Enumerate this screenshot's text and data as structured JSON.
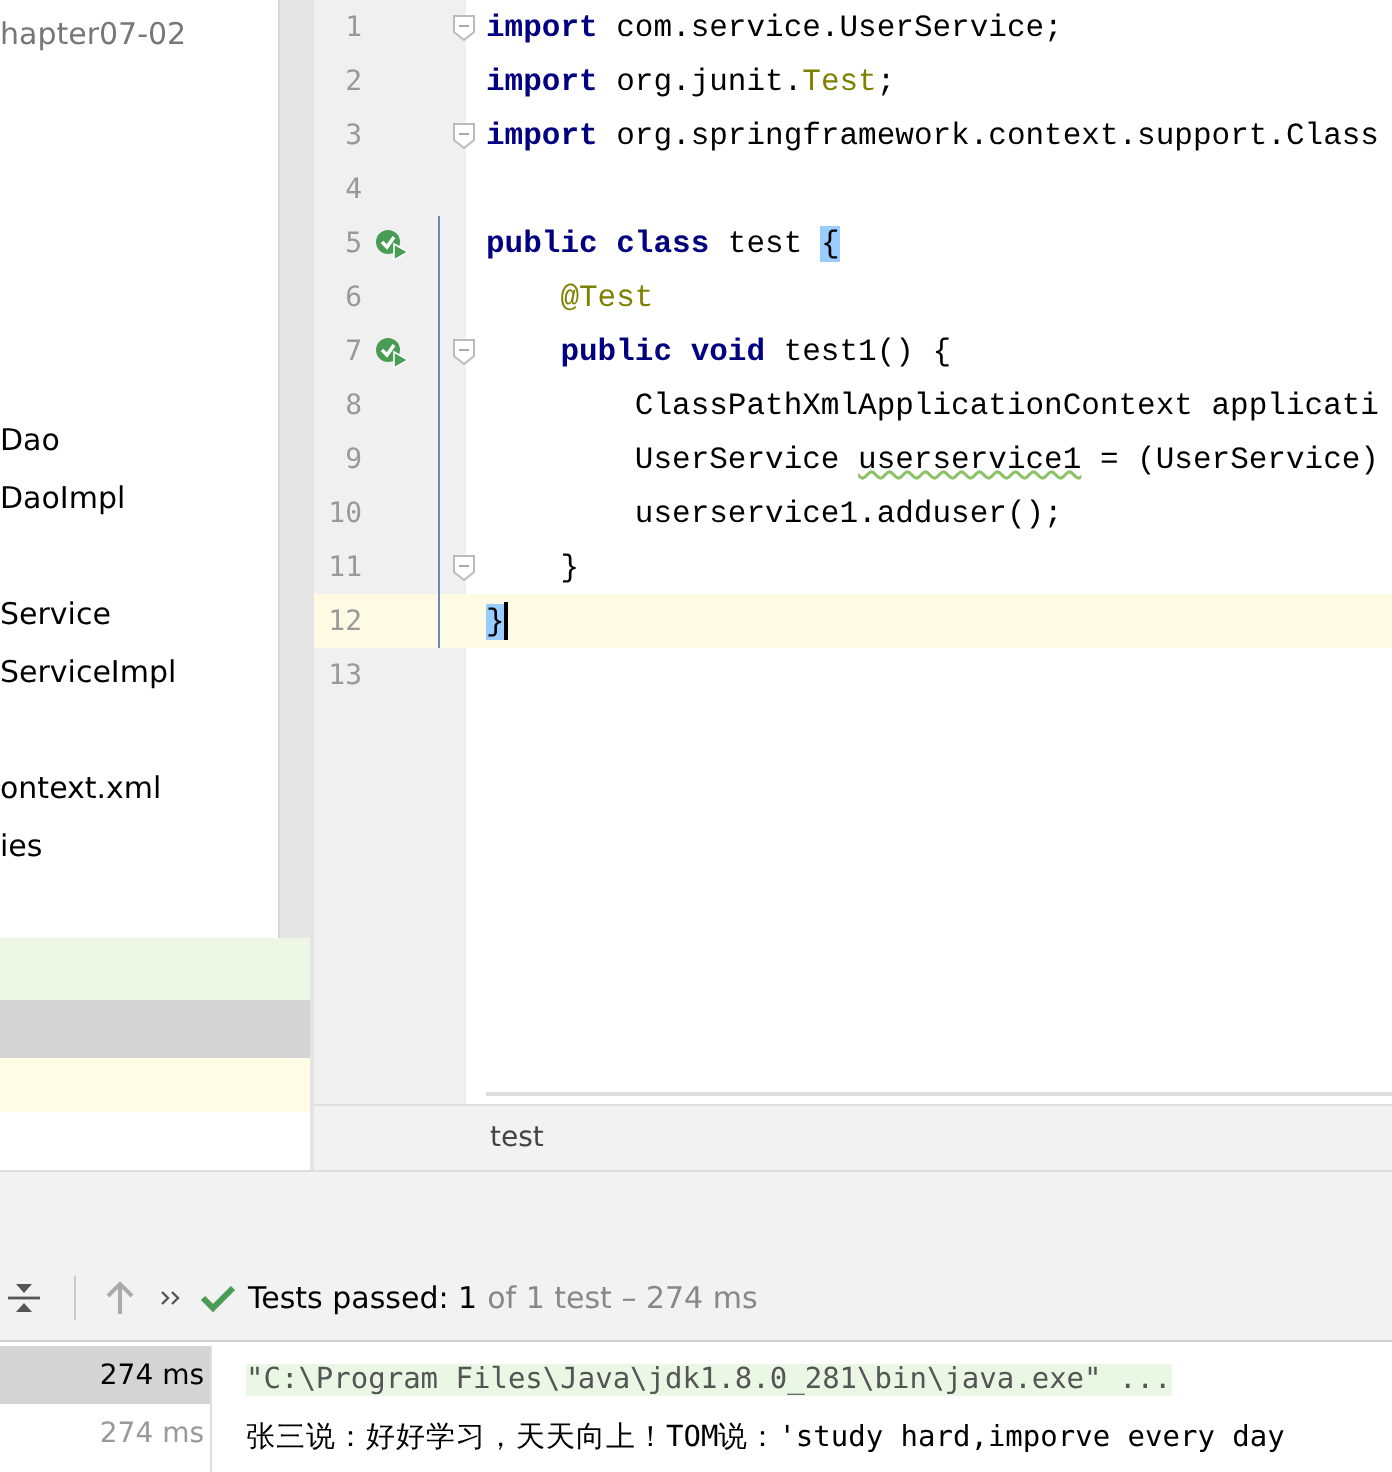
{
  "project_tree": {
    "items": [
      {
        "label": "hapter07-02",
        "kind": "root"
      },
      {
        "label": "Dao",
        "kind": "file"
      },
      {
        "label": "DaoImpl",
        "kind": "file"
      },
      {
        "label": "Service",
        "kind": "file"
      },
      {
        "label": "ServiceImpl",
        "kind": "file"
      },
      {
        "label": "ontext.xml",
        "kind": "file"
      },
      {
        "label": "ies",
        "kind": "file"
      }
    ]
  },
  "editor": {
    "lines": [
      {
        "number": "1",
        "fold": true,
        "run": false,
        "changed": false,
        "current": false,
        "tokens": [
          {
            "text": "import",
            "kind": "keyword"
          },
          {
            "text": " com.service.UserService;",
            "kind": "plain"
          }
        ]
      },
      {
        "number": "2",
        "fold": false,
        "run": false,
        "changed": false,
        "current": false,
        "tokens": [
          {
            "text": "import",
            "kind": "keyword"
          },
          {
            "text": " org.junit.",
            "kind": "plain"
          },
          {
            "text": "Test",
            "kind": "annotation"
          },
          {
            "text": ";",
            "kind": "plain"
          }
        ]
      },
      {
        "number": "3",
        "fold": true,
        "run": false,
        "changed": false,
        "current": false,
        "tokens": [
          {
            "text": "import",
            "kind": "keyword"
          },
          {
            "text": " org.springframework.context.support.Class",
            "kind": "plain"
          }
        ]
      },
      {
        "number": "4",
        "fold": false,
        "run": false,
        "changed": false,
        "current": false
      },
      {
        "number": "5",
        "fold": false,
        "run": true,
        "changed": true,
        "current": false,
        "tokens": [
          {
            "text": "public class",
            "kind": "keyword"
          },
          {
            "text": " test ",
            "kind": "plain"
          },
          {
            "text": "{",
            "kind": "brace-match"
          }
        ]
      },
      {
        "number": "6",
        "fold": false,
        "run": false,
        "changed": true,
        "current": false,
        "tokens": [
          {
            "text": "    @Test",
            "kind": "annotation"
          }
        ]
      },
      {
        "number": "7",
        "fold": true,
        "run": true,
        "changed": true,
        "current": false,
        "tokens": [
          {
            "text": "    public void",
            "kind": "keyword"
          },
          {
            "text": " test1() {",
            "kind": "plain"
          }
        ]
      },
      {
        "number": "8",
        "fold": false,
        "run": false,
        "changed": true,
        "current": false,
        "tokens": [
          {
            "text": "        ClassPathXmlApplicationContext applicati",
            "kind": "plain"
          }
        ]
      },
      {
        "number": "9",
        "fold": false,
        "run": false,
        "changed": true,
        "current": false,
        "tokens": [
          {
            "text": "        UserService ",
            "kind": "plain"
          },
          {
            "text": "userservice1",
            "kind": "warning"
          },
          {
            "text": " = (UserService)",
            "kind": "plain"
          }
        ]
      },
      {
        "number": "10",
        "fold": false,
        "run": false,
        "changed": true,
        "current": false,
        "tokens": [
          {
            "text": "        userservice1.adduser();",
            "kind": "plain"
          }
        ]
      },
      {
        "number": "11",
        "fold": true,
        "run": false,
        "changed": true,
        "current": false,
        "tokens": [
          {
            "text": "    }",
            "kind": "plain"
          }
        ]
      },
      {
        "number": "12",
        "fold": false,
        "run": false,
        "changed": true,
        "current": true,
        "tokens": [
          {
            "text": "}",
            "kind": "brace-match"
          }
        ]
      },
      {
        "number": "13",
        "fold": false,
        "run": false,
        "changed": false,
        "current": false
      }
    ]
  },
  "breadcrumb": "test",
  "test_runner": {
    "passed": true,
    "status": "Tests passed: 1",
    "detail": "of 1 test – 274 ms"
  },
  "results": [
    {
      "duration": "274 ms",
      "selected": true
    },
    {
      "duration": "274 ms",
      "selected": false
    }
  ],
  "console": [
    {
      "text": "\"C:\\Program Files\\Java\\jdk1.8.0_281\\bin\\java.exe\" ...",
      "kind": "command"
    },
    {
      "text": "张三说：好好学习，天天向上！TOM说：'study hard,imporve every day",
      "kind": "output"
    }
  ]
}
